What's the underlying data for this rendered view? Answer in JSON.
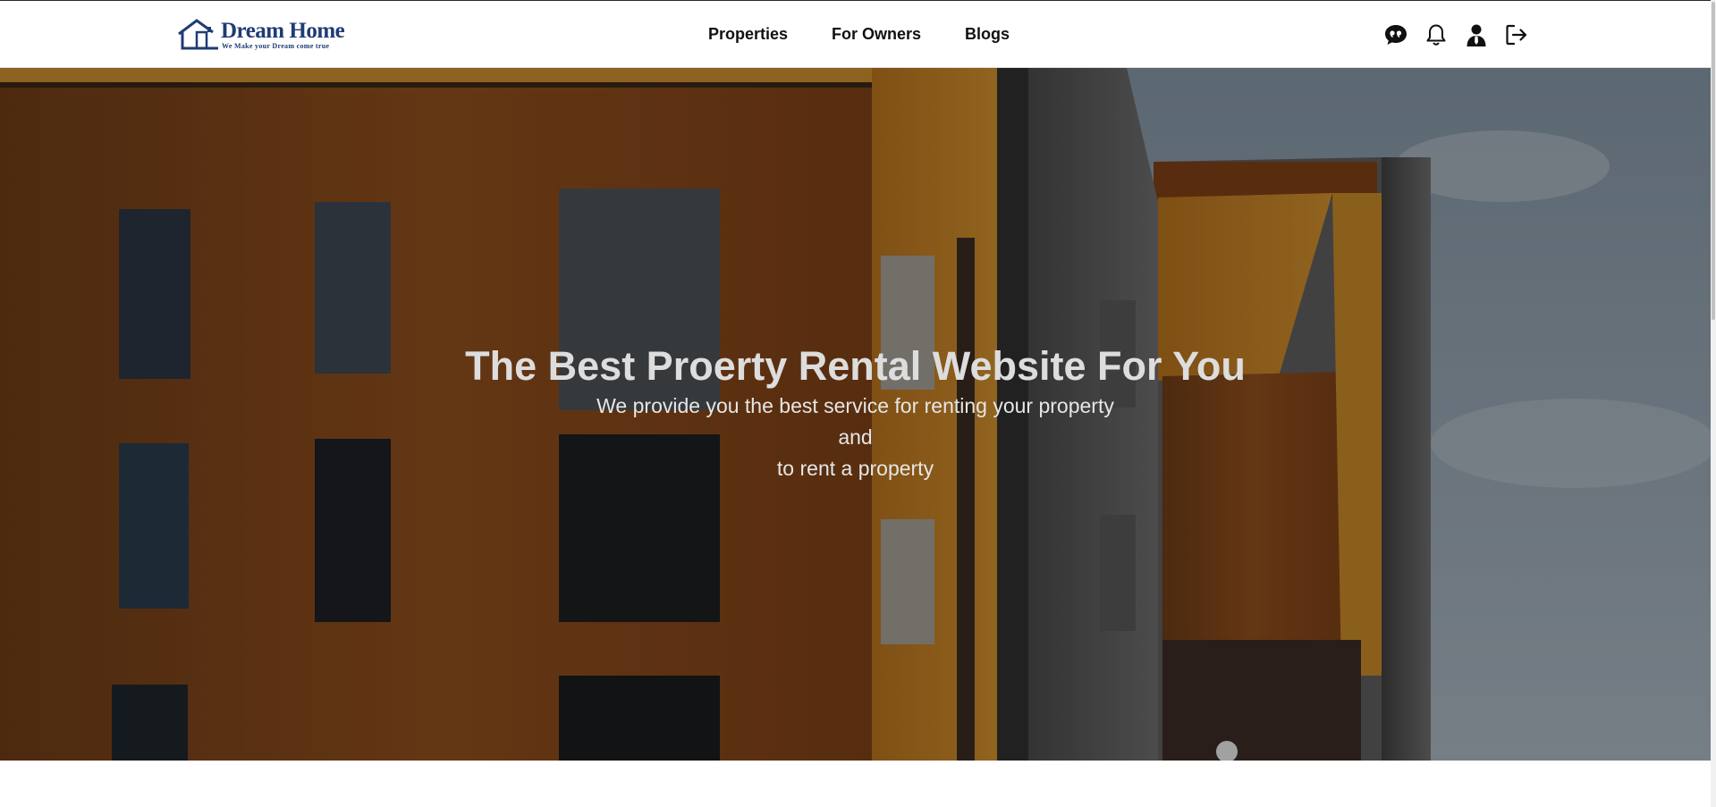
{
  "brand": {
    "name": "Dream Home",
    "tagline": "We Make your Dream come true",
    "color": "#1f3c73"
  },
  "nav": {
    "links": [
      "Properties",
      "For Owners",
      "Blogs"
    ],
    "icons": [
      "chat-quote-icon",
      "bell-icon",
      "user-icon",
      "logout-icon"
    ]
  },
  "hero": {
    "title": "The Best Proerty Rental Website For You",
    "subtitle_lines": [
      "We provide you the best service for renting your property",
      "and",
      "to rent a property"
    ]
  }
}
